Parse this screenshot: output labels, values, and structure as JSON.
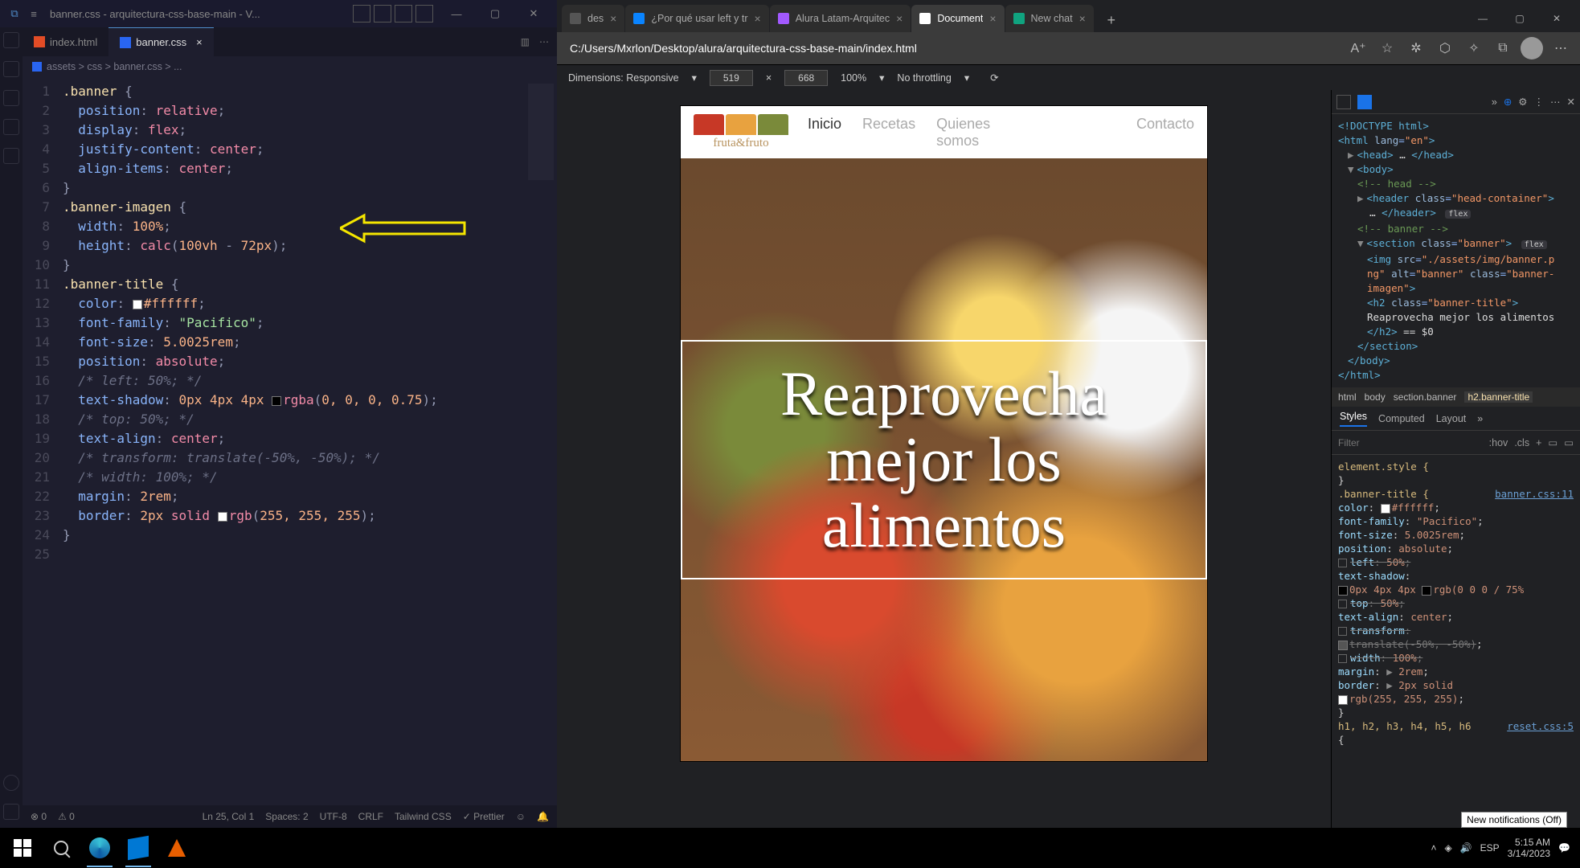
{
  "vscode": {
    "title": "banner.css - arquitectura-css-base-main - V...",
    "tabs": [
      {
        "label": "index.html",
        "active": false,
        "type": "html"
      },
      {
        "label": "banner.css",
        "active": true,
        "type": "css"
      }
    ],
    "breadcrumbs": "assets > css > banner.css > ...",
    "code_lines": [
      {
        "n": "1",
        "html": "<span class='sel'>.banner</span> <span class='punc'>{</span>"
      },
      {
        "n": "2",
        "html": "  <span class='prop'>position</span><span class='punc'>:</span> <span class='val'>relative</span><span class='punc'>;</span>"
      },
      {
        "n": "3",
        "html": "  <span class='prop'>display</span><span class='punc'>:</span> <span class='val'>flex</span><span class='punc'>;</span>"
      },
      {
        "n": "4",
        "html": "  <span class='prop'>justify-content</span><span class='punc'>:</span> <span class='val'>center</span><span class='punc'>;</span>"
      },
      {
        "n": "5",
        "html": "  <span class='prop'>align-items</span><span class='punc'>:</span> <span class='val'>center</span><span class='punc'>;</span>"
      },
      {
        "n": "6",
        "html": "<span class='punc'>}</span>"
      },
      {
        "n": "7",
        "html": "<span class='sel'>.banner-imagen</span> <span class='punc'>{</span>"
      },
      {
        "n": "8",
        "html": "  <span class='prop'>width</span><span class='punc'>:</span> <span class='num'>100%</span><span class='punc'>;</span>"
      },
      {
        "n": "9",
        "html": "  <span class='prop'>height</span><span class='punc'>:</span> <span class='val'>calc</span><span class='punc'>(</span><span class='num'>100vh</span> <span class='punc'>-</span> <span class='num'>72px</span><span class='punc'>);</span>"
      },
      {
        "n": "10",
        "html": "<span class='punc'>}</span>"
      },
      {
        "n": "11",
        "html": "<span class='sel'>.banner-title</span> <span class='punc'>{</span>"
      },
      {
        "n": "12",
        "html": "  <span class='prop'>color</span><span class='punc'>:</span> <span class='sw' style='background:#fff'></span><span class='num'>#ffffff</span><span class='punc'>;</span>"
      },
      {
        "n": "13",
        "html": "  <span class='prop'>font-family</span><span class='punc'>:</span> <span class='str'>\"Pacifico\"</span><span class='punc'>;</span>"
      },
      {
        "n": "14",
        "html": "  <span class='prop'>font-size</span><span class='punc'>:</span> <span class='num'>5.0025rem</span><span class='punc'>;</span>"
      },
      {
        "n": "15",
        "html": "  <span class='prop'>position</span><span class='punc'>:</span> <span class='val'>absolute</span><span class='punc'>;</span>"
      },
      {
        "n": "16",
        "html": "  <span class='cmnt'>/* left: 50%; */</span>"
      },
      {
        "n": "17",
        "html": "  <span class='prop'>text-shadow</span><span class='punc'>:</span> <span class='num'>0px 4px 4px</span> <span class='sw' style='background:#000'></span><span class='val'>rgba</span><span class='punc'>(</span><span class='num'>0, 0, 0, 0.75</span><span class='punc'>);</span>"
      },
      {
        "n": "18",
        "html": "  <span class='cmnt'>/* top: 50%; */</span>"
      },
      {
        "n": "19",
        "html": "  <span class='prop'>text-align</span><span class='punc'>:</span> <span class='val'>center</span><span class='punc'>;</span>"
      },
      {
        "n": "20",
        "html": "  <span class='cmnt'>/* transform: translate(-50%, -50%); */</span>"
      },
      {
        "n": "21",
        "html": "  <span class='cmnt'>/* width: 100%; */</span>"
      },
      {
        "n": "22",
        "html": "  <span class='prop'>margin</span><span class='punc'>:</span> <span class='num'>2rem</span><span class='punc'>;</span>"
      },
      {
        "n": "23",
        "html": "  <span class='prop'>border</span><span class='punc'>:</span> <span class='num'>2px</span> <span class='val'>solid</span> <span class='sw' style='background:#fff'></span><span class='val'>rgb</span><span class='punc'>(</span><span class='num'>255, 255, 255</span><span class='punc'>);</span>"
      },
      {
        "n": "24",
        "html": "<span class='punc'>}</span>"
      },
      {
        "n": "25",
        "html": ""
      }
    ],
    "status": {
      "errors": "⊗ 0",
      "warnings": "⚠ 0",
      "ln_col": "Ln 25, Col 1",
      "spaces": "Spaces: 2",
      "encoding": "UTF-8",
      "eol": "CRLF",
      "lang": "Tailwind CSS",
      "prettier": "✓ Prettier"
    }
  },
  "edge": {
    "tabs": [
      {
        "label": "des",
        "icon_bg": "#555"
      },
      {
        "label": "¿Por qué usar left y tr",
        "icon_bg": "#0a84ff",
        "prefix": "a"
      },
      {
        "label": "Alura Latam-Arquitec",
        "icon_bg": "#a259ff"
      },
      {
        "label": "Document",
        "icon_bg": "#fff",
        "active": true
      },
      {
        "label": "New chat",
        "icon_bg": "#10a37f"
      }
    ],
    "url": "C:/Users/Mxrlon/Desktop/alura/arquitectura-css-base-main/index.html",
    "devbar": {
      "dimensions_label": "Dimensions: Responsive",
      "w": "519",
      "h": "668",
      "zoom": "100%",
      "throttling": "No throttling"
    },
    "site": {
      "logo_text": "fruta&fruto",
      "nav": [
        "Inicio",
        "Recetas",
        "Quienes somos",
        "Contacto"
      ],
      "banner_title": "Reaprovecha mejor los alimentos"
    },
    "devtools": {
      "crumbs": [
        "html",
        "body",
        "section.banner",
        "h2.banner-title"
      ],
      "style_tabs": [
        "Styles",
        "Computed",
        "Layout"
      ],
      "filter_placeholder": "Filter",
      "hov": ":hov",
      "cls": ".cls",
      "dom_lines": [
        {
          "cls": "",
          "html": "<span class='tag'>&lt;!DOCTYPE html&gt;</span>"
        },
        {
          "cls": "",
          "html": "<span class='tag'>&lt;html</span> <span class='attr'>lang</span>=<span class='aval'>\"en\"</span><span class='tag'>&gt;</span>"
        },
        {
          "cls": "ind1",
          "html": "<span class='disc'>▶</span><span class='tag'>&lt;head&gt;</span> <span class='txt'>…</span> <span class='tag'>&lt;/head&gt;</span>"
        },
        {
          "cls": "ind1",
          "html": "<span class='disc'>▼</span><span class='tag'>&lt;body&gt;</span>"
        },
        {
          "cls": "ind2",
          "html": "<span class='cm'>&lt;!-- head --&gt;</span>"
        },
        {
          "cls": "ind2",
          "html": "<span class='disc'>▶</span><span class='tag'>&lt;header</span> <span class='attr'>class</span>=<span class='aval'>\"head-container\"</span><span class='tag'>&gt;</span>"
        },
        {
          "cls": "ind2",
          "html": "&nbsp;&nbsp;<span class='txt'>…</span> <span class='tag'>&lt;/header&gt;</span> <span class='pill'>flex</span>"
        },
        {
          "cls": "ind2",
          "html": "<span class='cm'>&lt;!-- banner --&gt;</span>"
        },
        {
          "cls": "ind2",
          "html": "<span class='disc'>▼</span><span class='tag'>&lt;section</span> <span class='attr'>class</span>=<span class='aval'>\"banner\"</span><span class='tag'>&gt;</span> <span class='pill'>flex</span>"
        },
        {
          "cls": "ind3",
          "html": "<span class='tag'>&lt;img</span> <span class='attr'>src</span>=<span class='aval'>\"./assets/img/banner.p</span>"
        },
        {
          "cls": "ind3",
          "html": "<span class='aval'>ng\"</span> <span class='attr'>alt</span>=<span class='aval'>\"banner\"</span> <span class='attr'>class</span>=<span class='aval'>\"banner-</span>"
        },
        {
          "cls": "ind3",
          "html": "<span class='aval'>imagen\"</span><span class='tag'>&gt;</span>"
        },
        {
          "cls": "ind3",
          "html": "<span class='tag'>&lt;h2</span> <span class='attr'>class</span>=<span class='aval'>\"banner-title\"</span><span class='tag'>&gt;</span>"
        },
        {
          "cls": "ind3",
          "html": "<span class='txt'>Reaprovecha mejor los alimentos</span>"
        },
        {
          "cls": "ind3",
          "html": "<span class='tag'>&lt;/h2&gt;</span> <span class='txt'>== $0</span>"
        },
        {
          "cls": "ind2",
          "html": "<span class='tag'>&lt;/section&gt;</span>"
        },
        {
          "cls": "ind1",
          "html": "<span class='tag'>&lt;/body&gt;</span>"
        },
        {
          "cls": "",
          "html": "<span class='tag'>&lt;/html&gt;</span>"
        }
      ],
      "rules": [
        {
          "sel": "element.style {",
          "src": "",
          "lines": [
            "}"
          ]
        },
        {
          "sel": ".banner-title {",
          "src": "banner.css:11",
          "lines": [
            "  <span class='rprop'>color</span>: <span class='sw' style='background:#fff'></span><span class='rval'>#ffffff</span>;",
            "  <span class='rprop'>font-family</span>: <span class='rval'>\"Pacifico\"</span>;",
            "  <span class='rprop'>font-size</span>: <span class='rval'>5.0025rem</span>;",
            "  <span class='rprop'>position</span>: <span class='rval'>absolute</span>;",
            "<span class='chk'></span><span class='strike'><span class='rprop'>left</span>: <span class='rval'>50%</span>;</span>",
            "  <span class='rprop'>text-shadow</span>:",
            "    <span class='sw' style='background:#000'></span><span class='rval'>0px 4px 4px</span> <span class='sw' style='background:#000'></span><span class='rval'>rgb(0 0 0 / 75%</span>",
            "<span class='chk'></span><span class='strike'><span class='rprop'>top</span>: <span class='rval'>50%</span>;</span>",
            "  <span class='rprop'>text-align</span>: <span class='rval'>center</span>;",
            "<span class='chk'></span><span class='strike'><span class='rprop'>transform</span>:</span>",
            "    <span class='sw' style='background:#555'></span><span class='strike rval'>translate(-50%, -50%)</span>;",
            "<span class='chk'></span><span class='strike'><span class='rprop'>width</span>: <span class='rval'>100%</span>;</span>",
            "  <span class='rprop'>margin</span>: <span class='expand'>▶</span> <span class='rval'>2rem</span>;",
            "  <span class='rprop'>border</span>: <span class='expand'>▶</span> <span class='rval'>2px solid</span>",
            "    <span class='sw' style='background:#fff'></span><span class='rval'>rgb(255, 255, 255)</span>;",
            "}"
          ]
        },
        {
          "sel": "h1, h2, h3, h4, h5, h6",
          "src": "reset.css:5",
          "lines": [
            "{"
          ]
        }
      ]
    }
  },
  "notification_tooltip": "New notifications (Off)",
  "taskbar": {
    "tray_lang": "ESP",
    "time": "5:15 AM",
    "date": "3/14/2023"
  }
}
